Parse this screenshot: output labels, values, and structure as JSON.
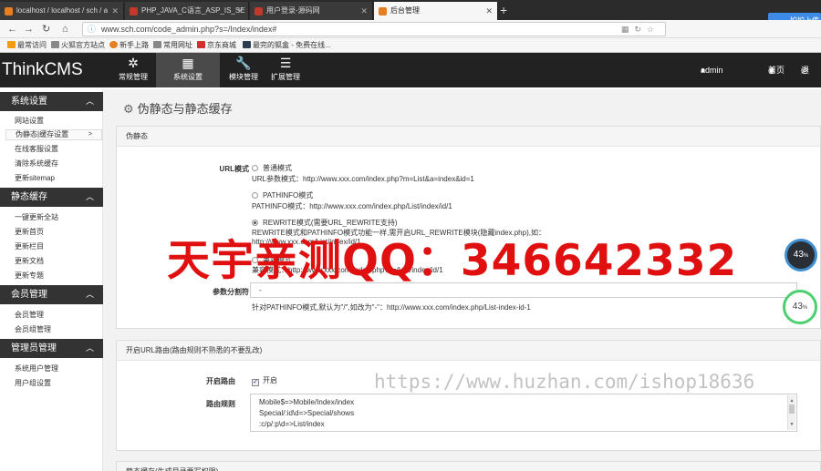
{
  "browser": {
    "tabs": [
      {
        "label": "localhost / localhost / sch / a",
        "color": "#e67e22"
      },
      {
        "label": "PHP_JAVA_C语言_ASP_IS_SE",
        "color": "#c0392b"
      },
      {
        "label": "用户登录-源码网",
        "color": "#c0392b"
      },
      {
        "label": "后台管理",
        "color": "#e67e22"
      }
    ],
    "new_tab": "+",
    "url": "www.sch.com/code_admin.php?s=/Index/index#",
    "cloud_button": "拍拍上传",
    "bookmarks": [
      {
        "label": "最常访问",
        "color": "#f39c12"
      },
      {
        "label": "火狐官方站点",
        "color": "#888888"
      },
      {
        "label": "新手上路",
        "color": "#e67e22"
      },
      {
        "label": "常用网址",
        "color": "#888888"
      },
      {
        "label": "京东商城",
        "color": "#d32f2f"
      },
      {
        "label": "最完的狐盒 - 免费在线...",
        "color": "#2c3e50"
      }
    ]
  },
  "app": {
    "brand": "ThinkCMS",
    "top_menu": [
      {
        "label": "常规管理",
        "icon": "✲"
      },
      {
        "label": "系统设置",
        "icon": "▦"
      },
      {
        "label": "模块管理",
        "icon": "🔧"
      },
      {
        "label": "扩展管理",
        "icon": "☰"
      }
    ],
    "user": "admin",
    "home": "首页",
    "logout": "退"
  },
  "sidebar": {
    "groups": [
      {
        "title": "系统设置",
        "items": [
          "网站设置",
          "伪静态|缓存设置",
          "在线客服设置",
          "清除系统缓存",
          "更新sitemap"
        ]
      },
      {
        "title": "静态缓存",
        "items": [
          "一键更新全站",
          "更新首页",
          "更新栏目",
          "更新文档",
          "更新专题"
        ]
      },
      {
        "title": "会员管理",
        "items": [
          "会员管理",
          "会员组管理"
        ]
      },
      {
        "title": "管理员管理",
        "items": [
          "系统用户管理",
          "用户组设置"
        ]
      }
    ],
    "chevron": "︿",
    "active_arrow": ">"
  },
  "main": {
    "title": "伪静态与静态缓存",
    "panel1": {
      "header": "伪静态",
      "url_mode_label": "URL模式",
      "options": [
        {
          "label": "普通模式",
          "desc": "URL参数模式：http://www.xxx.com/index.php?m=List&a=index&id=1",
          "checked": false
        },
        {
          "label": "PATHINFO模式",
          "desc": "PATHINFO模式：http://www.xxx.com/index.php/List/index/id/1",
          "checked": false
        },
        {
          "label": "REWRITE模式(需要URL_REWRITE支持)",
          "desc": "REWRITE模式和PATHINFO模式功能一样,需开启URL_REWRITE模块(隐藏index.php),如：",
          "desc2": "http://www.xxx.com/List/index/id/1",
          "checked": true
        },
        {
          "label": "兼容模式",
          "desc": "兼容模式：http://www.xxx.com/index.php?s=/List/index/id/1",
          "checked": false
        }
      ],
      "separator_label": "参数分割符",
      "separator_value": "-",
      "separator_hint": "针对PATHINFO模式,默认为\"/\",如改为\"-\"：http://www.xxx.com/index.php/List-index-id-1"
    },
    "panel2": {
      "header": "开启URL路由(路由规则不熟悉的不要乱改)",
      "route_label": "开启路由",
      "route_checkbox": "开启",
      "rules_label": "路由规则",
      "rules": [
        "Mobile$=>Mobile/Index/index",
        "Special/:id\\d=>Special/shows",
        ":c/p/:p\\d=>List/index"
      ]
    },
    "panel3_header": "静态缓存(生成目录要写权限)"
  },
  "overlays": {
    "red_watermark": "天宇亲测QQ：346642332",
    "grey_watermark": "https://www.huzhan.com/ishop18636",
    "gauge_dark": "43",
    "gauge_green": "43",
    "gauge_unit": "%"
  }
}
